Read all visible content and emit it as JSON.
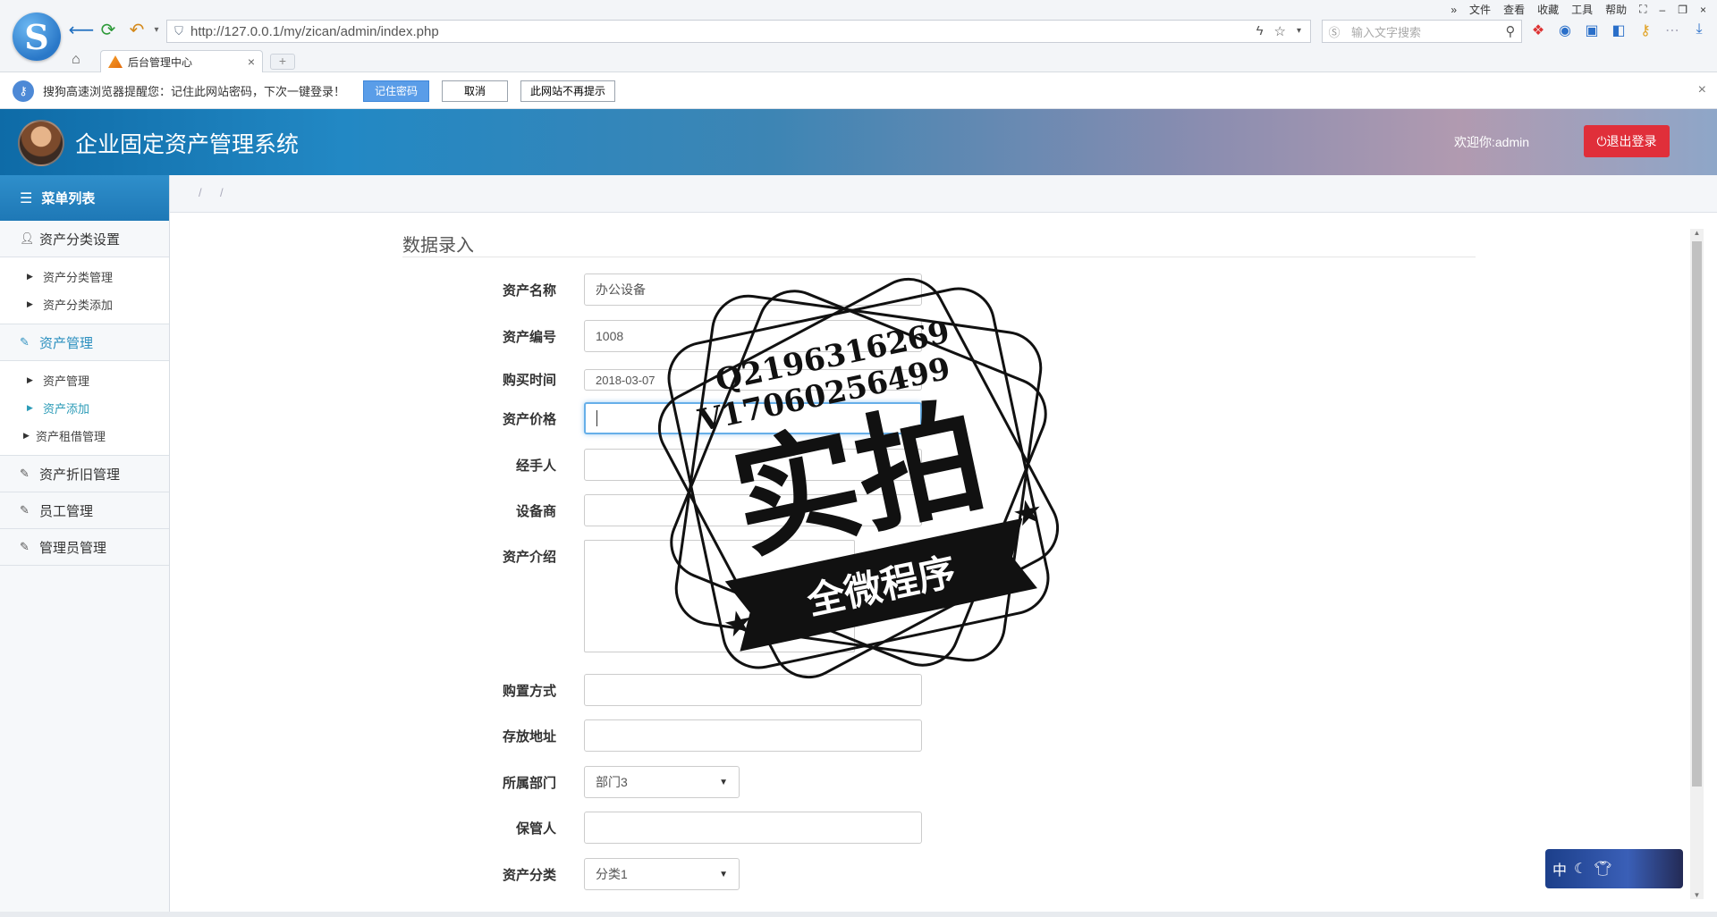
{
  "browser": {
    "url": "http://127.0.0.1/my/zican/admin/index.php",
    "search_placeholder": "输入文字搜索",
    "menu": [
      "文件",
      "查看",
      "收藏",
      "工具",
      "帮助"
    ],
    "tab_label": "后台管理中心",
    "tab_close": "×",
    "new_tab": "+"
  },
  "infobar": {
    "message": "搜狗高速浏览器提醒您：记住此网站密码，下次一键登录！",
    "remember": "记住密码",
    "cancel": "取消",
    "never": "此网站不再提示",
    "close": "×"
  },
  "header": {
    "title": "企业固定资产管理系统",
    "welcome": "欢迎你:admin",
    "logout": "⏻退出登录"
  },
  "sidebar": {
    "head": "菜单列表",
    "groups": [
      {
        "label": "资产分类设置",
        "items": [
          "资产分类管理",
          "资产分类添加"
        ]
      },
      {
        "label": "资产管理",
        "items": [
          "资产管理",
          "资产添加",
          "资产租借管理"
        ]
      },
      {
        "label": "资产折旧管理"
      },
      {
        "label": "员工管理"
      },
      {
        "label": "管理员管理"
      }
    ]
  },
  "breadcrumb": [
    "/",
    "/"
  ],
  "form": {
    "title": "数据录入",
    "fields": {
      "name": {
        "label": "资产名称",
        "value": "办公设备"
      },
      "code": {
        "label": "资产编号",
        "value": "1008"
      },
      "date": {
        "label": "购买时间",
        "value": "2018-03-07"
      },
      "price": {
        "label": "资产价格",
        "value": ""
      },
      "handler": {
        "label": "经手人",
        "value": ""
      },
      "supplier": {
        "label": "设备商",
        "value": ""
      },
      "intro": {
        "label": "资产介绍",
        "value": ""
      },
      "method": {
        "label": "购置方式",
        "value": ""
      },
      "location": {
        "label": "存放地址",
        "value": ""
      },
      "dept": {
        "label": "所属部门",
        "value": "部门3"
      },
      "keeper": {
        "label": "保管人",
        "value": ""
      },
      "category": {
        "label": "资产分类",
        "value": "分类1"
      }
    }
  },
  "watermark": {
    "line1": "Q2196316269",
    "line2": "V17060256499",
    "main": "实拍",
    "ribbon": "全微程序"
  },
  "ime": {
    "label": "中"
  }
}
